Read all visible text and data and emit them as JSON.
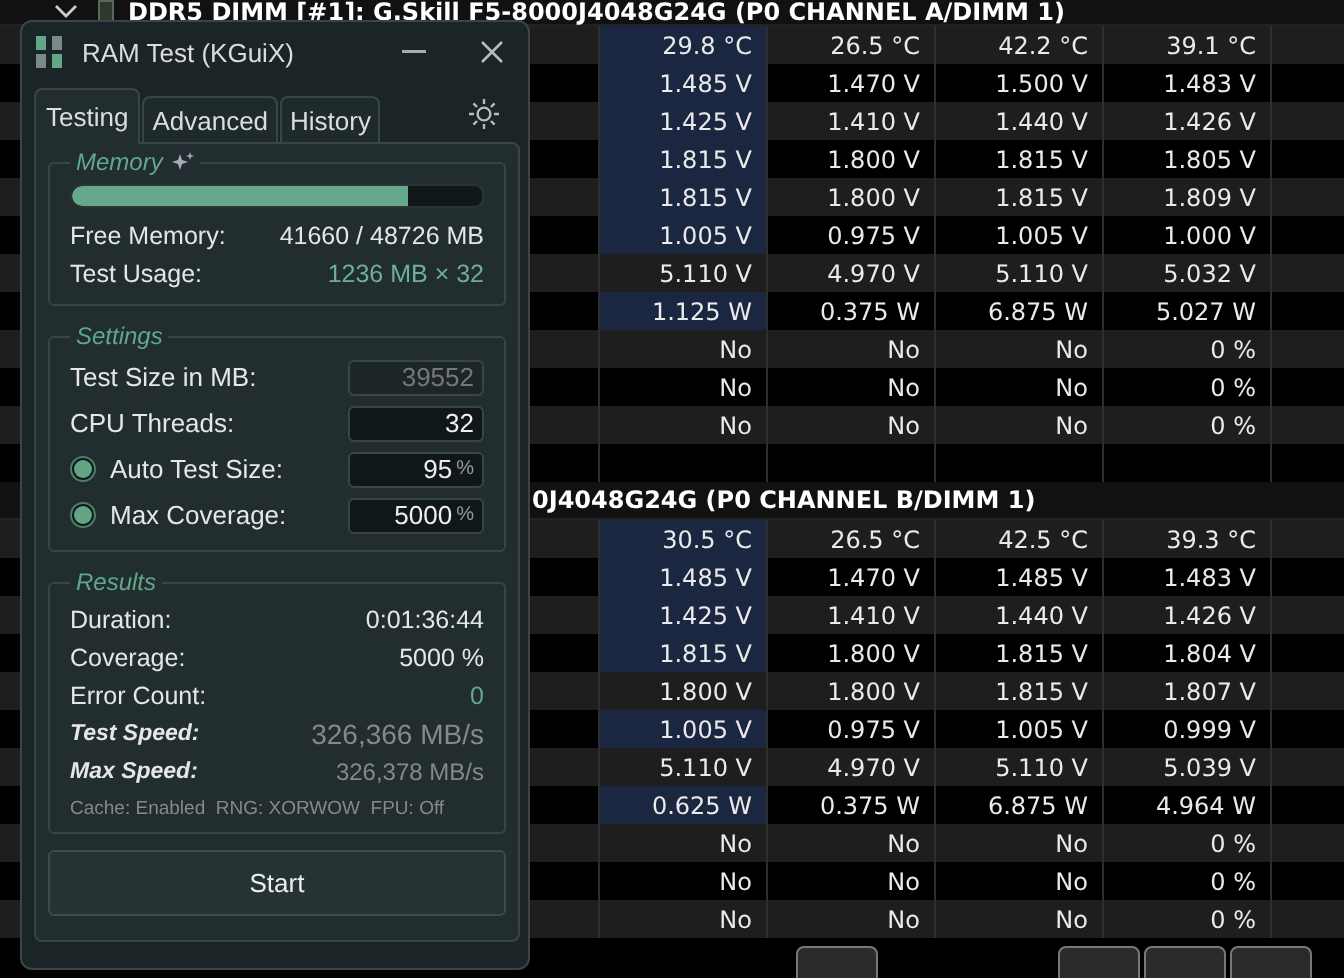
{
  "sensor_table": {
    "sections": [
      {
        "title": "DDR5 DIMM [#1]: G.Skill F5-8000J4048G24G (P0 CHANNEL A/DIMM 1)",
        "rows": [
          {
            "values": [
              "29.8 °C",
              "26.5 °C",
              "42.2 °C",
              "39.1 °C"
            ],
            "highlighted": true
          },
          {
            "values": [
              "1.485 V",
              "1.470 V",
              "1.500 V",
              "1.483 V"
            ],
            "highlighted": true
          },
          {
            "values": [
              "1.425 V",
              "1.410 V",
              "1.440 V",
              "1.426 V"
            ],
            "highlighted": true
          },
          {
            "values": [
              "1.815 V",
              "1.800 V",
              "1.815 V",
              "1.805 V"
            ],
            "highlighted": true
          },
          {
            "values": [
              "1.815 V",
              "1.800 V",
              "1.815 V",
              "1.809 V"
            ],
            "highlighted": true
          },
          {
            "values": [
              "1.005 V",
              "0.975 V",
              "1.005 V",
              "1.000 V"
            ],
            "highlighted": true
          },
          {
            "values": [
              "5.110 V",
              "4.970 V",
              "5.110 V",
              "5.032 V"
            ],
            "highlighted": false
          },
          {
            "values": [
              "1.125 W",
              "0.375 W",
              "6.875 W",
              "5.027 W"
            ],
            "highlighted": true
          },
          {
            "values": [
              "No",
              "No",
              "No",
              "0 %"
            ],
            "highlighted": false
          },
          {
            "values": [
              "No",
              "No",
              "No",
              "0 %"
            ],
            "highlighted": false
          },
          {
            "values": [
              "No",
              "No",
              "No",
              "0 %"
            ],
            "highlighted": false
          },
          {
            "values": [],
            "highlighted": false
          }
        ]
      },
      {
        "title": "0J4048G24G (P0 CHANNEL B/DIMM 1)",
        "rows": [
          {
            "values": [
              "30.5 °C",
              "26.5 °C",
              "42.5 °C",
              "39.3 °C"
            ],
            "highlighted": true
          },
          {
            "values": [
              "1.485 V",
              "1.470 V",
              "1.485 V",
              "1.483 V"
            ],
            "highlighted": true
          },
          {
            "values": [
              "1.425 V",
              "1.410 V",
              "1.440 V",
              "1.426 V"
            ],
            "highlighted": true
          },
          {
            "values": [
              "1.815 V",
              "1.800 V",
              "1.815 V",
              "1.804 V"
            ],
            "highlighted": true
          },
          {
            "values": [
              "1.800 V",
              "1.800 V",
              "1.815 V",
              "1.807 V"
            ],
            "highlighted": false
          },
          {
            "values": [
              "1.005 V",
              "0.975 V",
              "1.005 V",
              "0.999 V"
            ],
            "highlighted": true
          },
          {
            "values": [
              "5.110 V",
              "4.970 V",
              "5.110 V",
              "5.039 V"
            ],
            "highlighted": false
          },
          {
            "values": [
              "0.625 W",
              "0.375 W",
              "6.875 W",
              "4.964 W"
            ],
            "highlighted": true
          },
          {
            "values": [
              "No",
              "No",
              "No",
              "0 %"
            ],
            "highlighted": false
          },
          {
            "values": [
              "No",
              "No",
              "No",
              "0 %"
            ],
            "highlighted": false
          },
          {
            "values": [
              "No",
              "No",
              "No",
              "0 %"
            ],
            "highlighted": false
          }
        ]
      }
    ]
  },
  "dialog": {
    "title": "RAM Test (KGuiX)",
    "tabs": [
      {
        "label": "Testing",
        "selected": true
      },
      {
        "label": "Advanced",
        "selected": false
      },
      {
        "label": "History",
        "selected": false
      }
    ],
    "memory": {
      "heading": "Memory",
      "level": 0.82,
      "free_label": "Free Memory:",
      "free_value": "41660 / 48726 MB",
      "usage_label": "Test Usage:",
      "usage_value": "1236 MB × 32"
    },
    "settings": {
      "heading": "Settings",
      "fields": [
        {
          "kind": "plain",
          "label": "Test Size in MB:",
          "value": "39552",
          "disabled": true
        },
        {
          "kind": "plain",
          "label": "CPU Threads:",
          "value": "32",
          "disabled": false
        },
        {
          "kind": "radio",
          "label": "Auto Test Size:",
          "value": "95",
          "unit": "%",
          "disabled": false,
          "checked": true
        },
        {
          "kind": "radio",
          "label": "Max Coverage:",
          "value": "5000",
          "unit": "%",
          "disabled": false,
          "checked": true
        }
      ]
    },
    "results": {
      "heading": "Results",
      "rows": [
        {
          "kind": "plain",
          "label": "Duration:",
          "value": "0:01:36:44"
        },
        {
          "kind": "plain",
          "label": "Coverage:",
          "value": "5000 %"
        },
        {
          "kind": "good",
          "label": "Error Count:",
          "value": "0"
        },
        {
          "kind": "speed",
          "label": "Test Speed:",
          "value": "326,366 MB/s"
        },
        {
          "kind": "speed_small",
          "label": "Max Speed:",
          "value": "326,378 MB/s"
        }
      ],
      "footnote": "Cache: Enabled  RNG: XORWOW  FPU: Off"
    },
    "start_button": "Start"
  }
}
